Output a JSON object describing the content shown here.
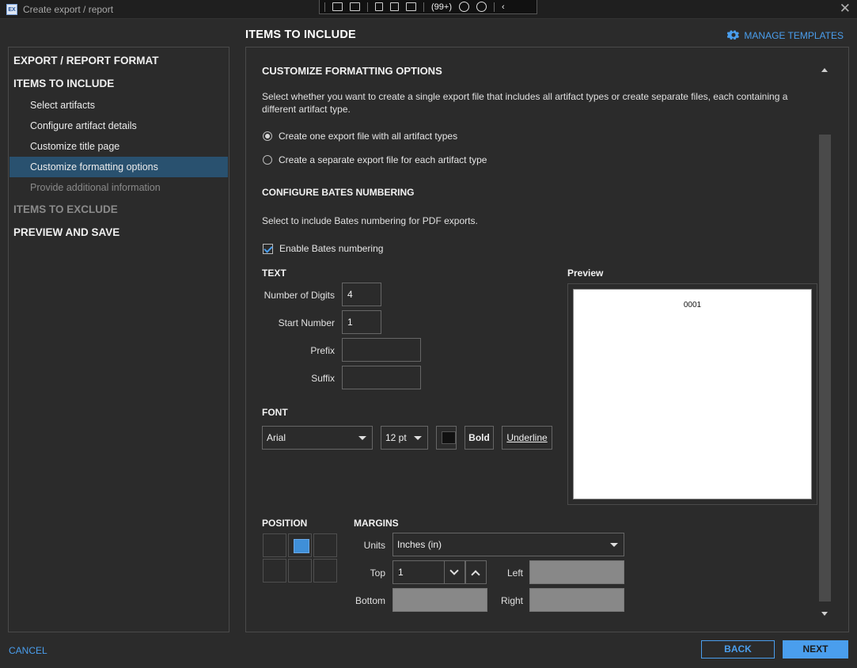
{
  "window": {
    "title": "Create export / report",
    "app_icon_text": "EX"
  },
  "toolbar": {
    "badge": "99+"
  },
  "sidebar": {
    "sections": [
      {
        "label": "EXPORT / REPORT FORMAT"
      },
      {
        "label": "ITEMS TO INCLUDE"
      },
      {
        "label": "ITEMS TO EXCLUDE"
      },
      {
        "label": "PREVIEW AND SAVE"
      }
    ],
    "items": [
      {
        "label": "Select artifacts"
      },
      {
        "label": "Configure artifact details"
      },
      {
        "label": "Customize title page"
      },
      {
        "label": "Customize formatting options"
      },
      {
        "label": "Provide additional information"
      }
    ]
  },
  "header": {
    "title": "ITEMS TO INCLUDE",
    "manage_templates": "MANAGE TEMPLATES"
  },
  "formatting": {
    "title": "CUSTOMIZE FORMATTING OPTIONS",
    "description": "Select whether you want to create a single export file that includes all artifact types or create separate files, each containing a different artifact type.",
    "option_single": "Create one export file with all artifact types",
    "option_separate": "Create a separate export file for each artifact type"
  },
  "bates": {
    "title": "CONFIGURE BATES NUMBERING",
    "description": "Select to include Bates numbering for PDF exports.",
    "enable_label": "Enable Bates numbering",
    "text_heading": "TEXT",
    "digits_label": "Number of Digits",
    "digits_value": "4",
    "start_label": "Start Number",
    "start_value": "1",
    "prefix_label": "Prefix",
    "prefix_value": "",
    "suffix_label": "Suffix",
    "suffix_value": "",
    "preview_heading": "Preview",
    "preview_text": "0001",
    "font_heading": "FONT",
    "font_family": "Arial",
    "font_size": "12 pt",
    "font_color": "#111111",
    "bold_label": "Bold",
    "underline_label": "Underline",
    "position_heading": "POSITION",
    "margins_heading": "MARGINS",
    "units_label": "Units",
    "units_value": "Inches (in)",
    "top_label": "Top",
    "top_value": "1",
    "left_label": "Left",
    "left_value": "",
    "bottom_label": "Bottom",
    "bottom_value": "",
    "right_label": "Right",
    "right_value": ""
  },
  "footer": {
    "cancel": "CANCEL",
    "back": "BACK",
    "next": "NEXT"
  },
  "colors": {
    "accent": "#4a9eed",
    "active_nav": "#29516f",
    "background": "#2b2b2b"
  }
}
